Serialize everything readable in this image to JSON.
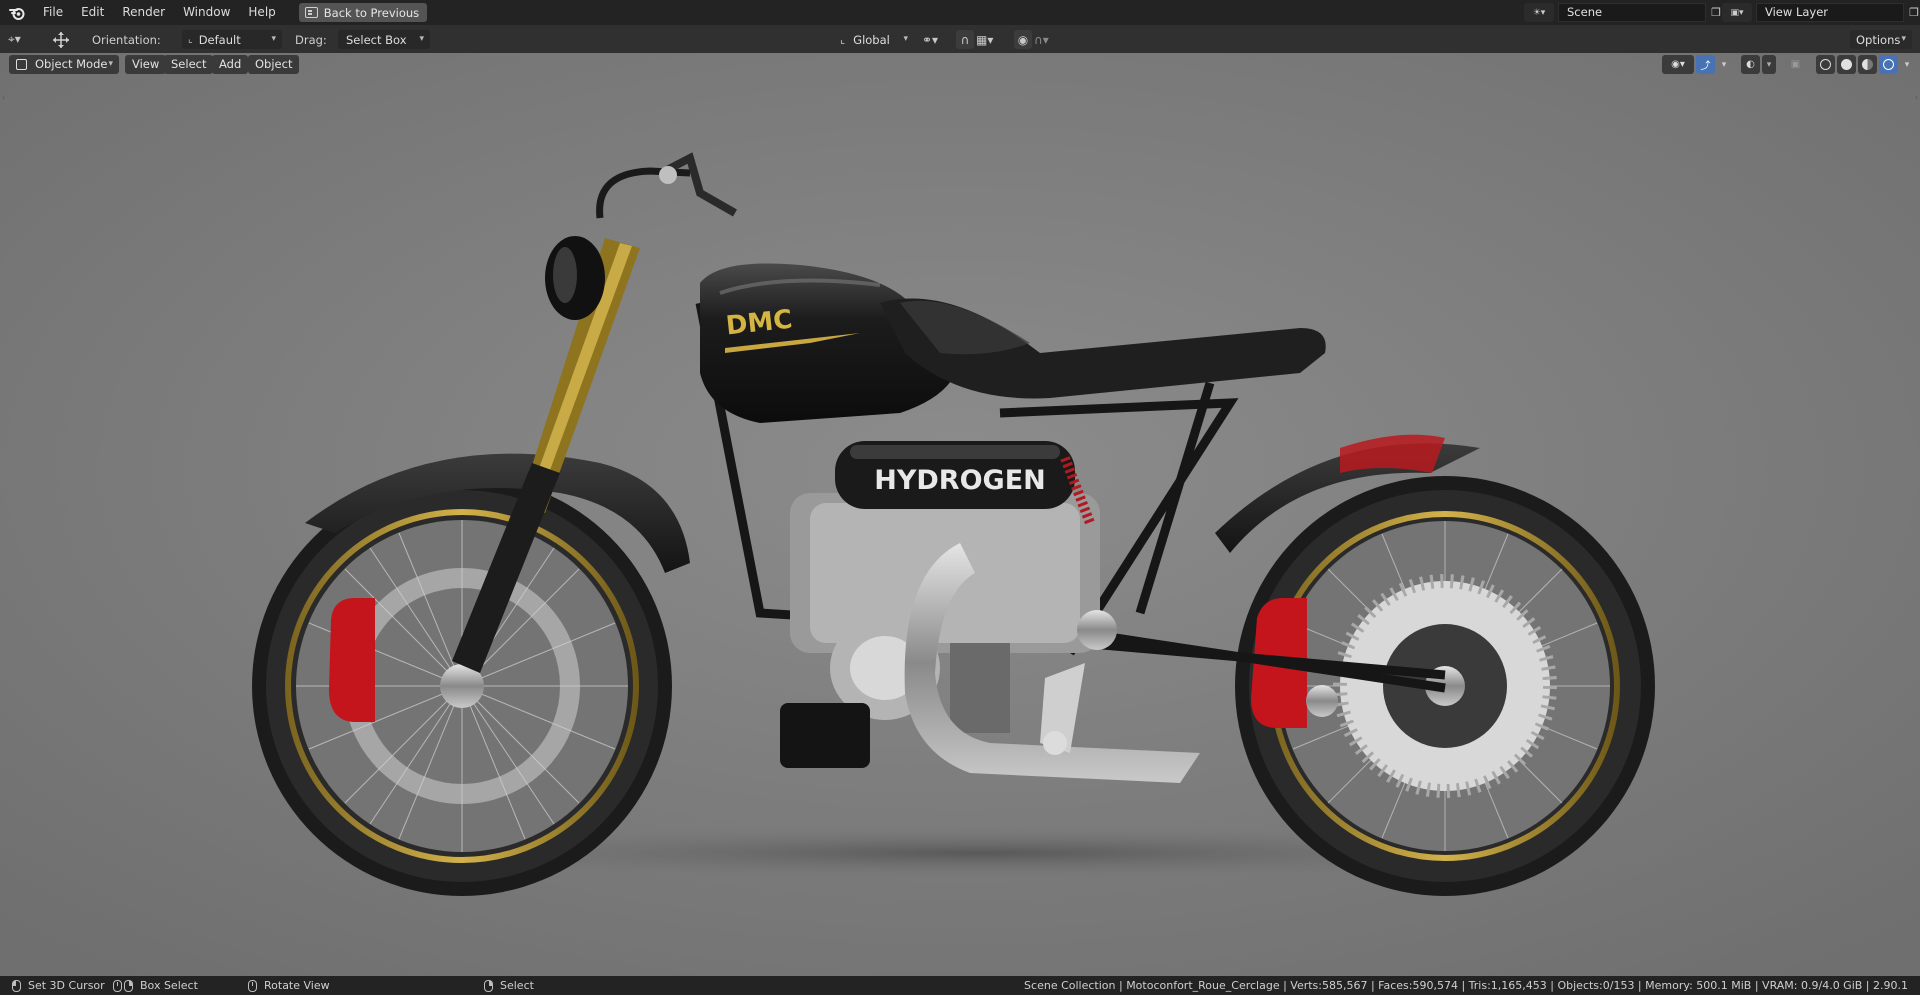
{
  "menubar": {
    "items": [
      "File",
      "Edit",
      "Render",
      "Window",
      "Help"
    ],
    "back_button": "Back to Previous",
    "scene_name": "Scene",
    "view_layer_name": "View Layer"
  },
  "toolbar": {
    "orientation_label": "Orientation:",
    "orientation_value": "Default",
    "drag_label": "Drag:",
    "drag_value": "Select Box",
    "transform_orientation": "Global",
    "options_label": "Options"
  },
  "viewport_header": {
    "mode": "Object Mode",
    "menus": [
      "View",
      "Select",
      "Add",
      "Object"
    ]
  },
  "viewport": {
    "tank_logo": "DMC",
    "engine_label": "HYDROGEN"
  },
  "statusbar": {
    "hint_left": "Set 3D Cursor",
    "hint_middle": "Box Select",
    "hint_rotate": "Rotate View",
    "hint_select": "Select",
    "stats": "Scene Collection | Motoconfort_Roue_Cerclage | Verts:585,567 | Faces:590,574 | Tris:1,165,453 | Objects:0/153 | Memory: 500.1 MiB | VRAM: 0.9/4.0 GiB | 2.90.1"
  },
  "colors": {
    "viewport_bg": "#7e7e7e",
    "accent_blue": "#4772b3",
    "brake_red": "#c4141c",
    "gold": "#c8a640"
  }
}
